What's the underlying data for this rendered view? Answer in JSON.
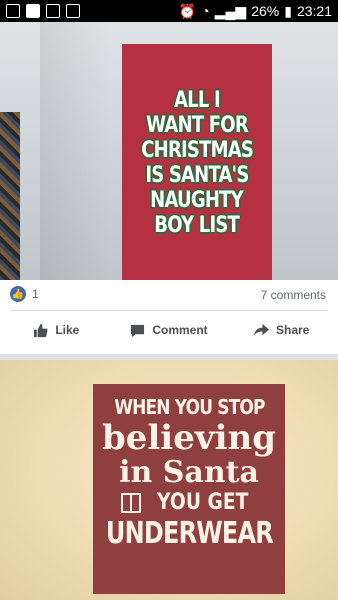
{
  "status_bar": {
    "battery": "26%",
    "time": "23:21",
    "icons": [
      "image-icon",
      "info-icon",
      "mail-icon",
      "person-icon",
      "alarm-icon",
      "wifi-icon",
      "signal-icon",
      "battery-icon"
    ]
  },
  "post1": {
    "shirt_print_lines": [
      "ALL I",
      "WANT FOR",
      "CHRISTMAS",
      "IS SANTA'S",
      "NAUGHTY",
      "BOY LIST"
    ],
    "reactions_count": "1",
    "comments_count": "7 comments",
    "actions": {
      "like": "Like",
      "comment": "Comment",
      "share": "Share"
    }
  },
  "post2": {
    "shirt_print_lines": [
      "WHEN YOU STOP",
      "believing",
      "in Santa",
      "YOU GET",
      "UNDERWEAR"
    ]
  },
  "colors": {
    "facebook_blue": "#4267b2",
    "print1_red": "#b53040",
    "print1_outline_green": "#2c6b3a",
    "print2_maroon": "#8f3f3d"
  }
}
